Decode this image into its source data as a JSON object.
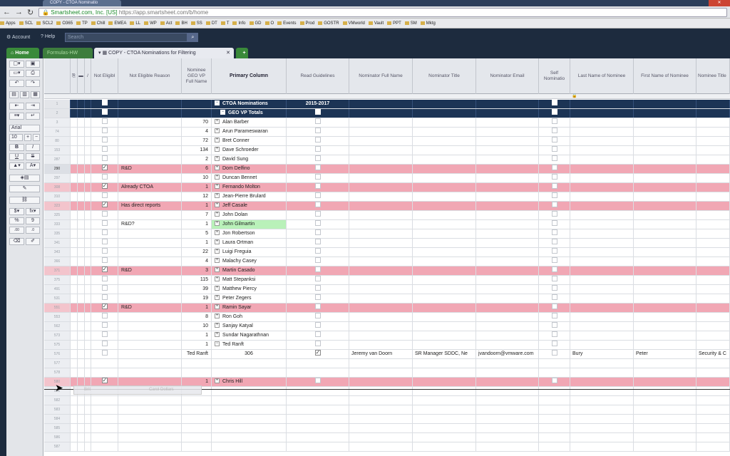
{
  "browser": {
    "tab_title": "COPY - CTOA Nominatio",
    "url_site": "Smartsheet.com, Inc. [US]",
    "url_text": "https://app.smartsheet.com/b/home",
    "bookmarks": [
      "Apps",
      "SCL",
      "SCL2",
      "O365",
      "TP",
      "Chill",
      "EMEA",
      "LL",
      "WP",
      "Act",
      "BH",
      "SS",
      "DT",
      "T",
      "Info",
      "GD",
      "O",
      "Events",
      "Prod",
      "GOSTR",
      "VMworld",
      "Vault",
      "PPT",
      "SM",
      "Mktg"
    ]
  },
  "appbar": {
    "account_label": "Account",
    "help_label": "Help",
    "search_placeholder": "Search"
  },
  "tabs": {
    "home": "Home",
    "formulas": "Formulas-HW",
    "sheet": "COPY - CTOA Nominations for Filtering",
    "add": "+"
  },
  "toolbar": {
    "font_name": "Arial",
    "font_size": "10",
    "bold": "B",
    "italic": "I",
    "underline": "U",
    "strike": "S",
    "currency": "$",
    "percent": "%",
    "thousands": "9",
    "decimal_add": ".00",
    "decimal_remove": ".0"
  },
  "columns": {
    "not_eligible": "Not Eligibl",
    "not_eligible_reason": "Not Eligible Reason",
    "geo_vp": "Nominee GEO VP Full Name",
    "primary": "Primary Column",
    "read_guidelines": "Read Guidelines",
    "nominator_full_name": "Nominator Full Name",
    "nominator_title": "Nominator Title",
    "nominator_email": "Nominator Email",
    "self_nomination": "Self Nominatio",
    "last_name_nominee": "Last Name of Nominee",
    "first_name_nominee": "First Name of Nominee",
    "nominee_title": "Nominee Title"
  },
  "rows": [
    {
      "num": "1",
      "type": "navy",
      "primary": "CTOA Nominations",
      "rg": "2015-2017",
      "geo": "",
      "exp": "−",
      "bold": true
    },
    {
      "num": "2",
      "type": "navy",
      "primary": "GEO VP Totals",
      "rg": "",
      "geo": "",
      "exp": "−",
      "bold": true,
      "indent": true
    },
    {
      "num": "3",
      "type": "",
      "geo": "70",
      "primary": "Alan Barber",
      "exp": "+"
    },
    {
      "num": "74",
      "type": "",
      "geo": "4",
      "primary": "Arun Parameswaran",
      "exp": "+"
    },
    {
      "num": "80",
      "type": "",
      "geo": "72",
      "primary": "Bret Conner",
      "exp": "+"
    },
    {
      "num": "153",
      "type": "",
      "geo": "134",
      "primary": "Dave Schroeder",
      "exp": "+"
    },
    {
      "num": "287",
      "type": "",
      "geo": "2",
      "primary": "David Sung",
      "exp": "+"
    },
    {
      "num": "290",
      "type": "pink",
      "ne": true,
      "reason": "R&D",
      "geo": "6",
      "primary": "Dom Delfino",
      "exp": "+",
      "active": true
    },
    {
      "num": "297",
      "type": "",
      "geo": "10",
      "primary": "Duncan Bennet",
      "exp": "+"
    },
    {
      "num": "308",
      "type": "pink",
      "ne": true,
      "reason": "Already CTOA",
      "geo": "1",
      "primary": "Fernando Molton",
      "exp": "+"
    },
    {
      "num": "310",
      "type": "",
      "geo": "12",
      "primary": "Jean-Pierre Brulard",
      "exp": "+"
    },
    {
      "num": "323",
      "type": "pink",
      "ne": true,
      "reason": "Has direct reports",
      "geo": "1",
      "primary": "Jeff Casale",
      "exp": "+"
    },
    {
      "num": "325",
      "type": "",
      "geo": "7",
      "primary": "John Dolan",
      "exp": "+"
    },
    {
      "num": "333",
      "type": "",
      "reason": "R&D?",
      "geo": "1",
      "primary": "John Gilmartin",
      "exp": "+",
      "green": true
    },
    {
      "num": "335",
      "type": "",
      "geo": "5",
      "primary": "Jon Robertson",
      "exp": "+"
    },
    {
      "num": "341",
      "type": "",
      "geo": "1",
      "primary": "Laura Ortman",
      "exp": "+"
    },
    {
      "num": "343",
      "type": "",
      "geo": "22",
      "primary": "Luigi Freguia",
      "exp": "+"
    },
    {
      "num": "366",
      "type": "",
      "geo": "4",
      "primary": "Malachy Casey",
      "exp": "+"
    },
    {
      "num": "371",
      "type": "pink",
      "ne": true,
      "reason": "R&D",
      "geo": "3",
      "primary": "Martin Casado",
      "exp": "+"
    },
    {
      "num": "375",
      "type": "",
      "geo": "115",
      "primary": "Matt Stepanksi",
      "exp": "+"
    },
    {
      "num": "491",
      "type": "",
      "geo": "39",
      "primary": "Matthew Piercy",
      "exp": "+"
    },
    {
      "num": "531",
      "type": "",
      "geo": "19",
      "primary": "Peter Zegers",
      "exp": "+"
    },
    {
      "num": "551",
      "type": "pink",
      "ne": true,
      "reason": "R&D",
      "geo": "1",
      "primary": "Ramin Sayar",
      "exp": "+"
    },
    {
      "num": "553",
      "type": "",
      "geo": "8",
      "primary": "Ron Goh",
      "exp": "+"
    },
    {
      "num": "562",
      "type": "",
      "geo": "10",
      "primary": "Sanjay Katyal",
      "exp": "+"
    },
    {
      "num": "573",
      "type": "",
      "geo": "1",
      "primary": "Sundar Nagarathnan",
      "exp": "+"
    },
    {
      "num": "575",
      "type": "",
      "geo": "1",
      "primary": "Ted Ranft",
      "exp": "−"
    },
    {
      "num": "576",
      "type": "",
      "geo": "Ted Ranft",
      "primary": "306",
      "rgcheck": true,
      "nfn": "Jeremy van Doorn",
      "nt": "SR Manager SDDC, Ne",
      "ne2": "jvandoorn@vmware.com",
      "ln": "Bury",
      "fn": "Peter",
      "nti": "Security & C"
    },
    {
      "num": "577",
      "type": "",
      "geo": "",
      "primary": ""
    },
    {
      "num": "578",
      "type": "",
      "geo": "",
      "primary": ""
    },
    {
      "num": "580",
      "type": "pink",
      "ne": true,
      "reason": "",
      "geo": "1",
      "primary": "Chris Hill",
      "exp": "+"
    },
    {
      "num": "581",
      "type": "",
      "geo": "",
      "primary": ""
    },
    {
      "num": "582",
      "type": "",
      "geo": "",
      "primary": ""
    },
    {
      "num": "583",
      "type": "",
      "geo": "",
      "primary": ""
    },
    {
      "num": "584",
      "type": "",
      "geo": "",
      "primary": ""
    },
    {
      "num": "585",
      "type": "",
      "geo": "",
      "primary": ""
    },
    {
      "num": "586",
      "type": "",
      "geo": "",
      "primary": ""
    },
    {
      "num": "587",
      "type": "",
      "geo": "",
      "primary": ""
    }
  ],
  "drag_ghost": {
    "left_text": "Brit",
    "right_text": "Carol Dollars"
  }
}
